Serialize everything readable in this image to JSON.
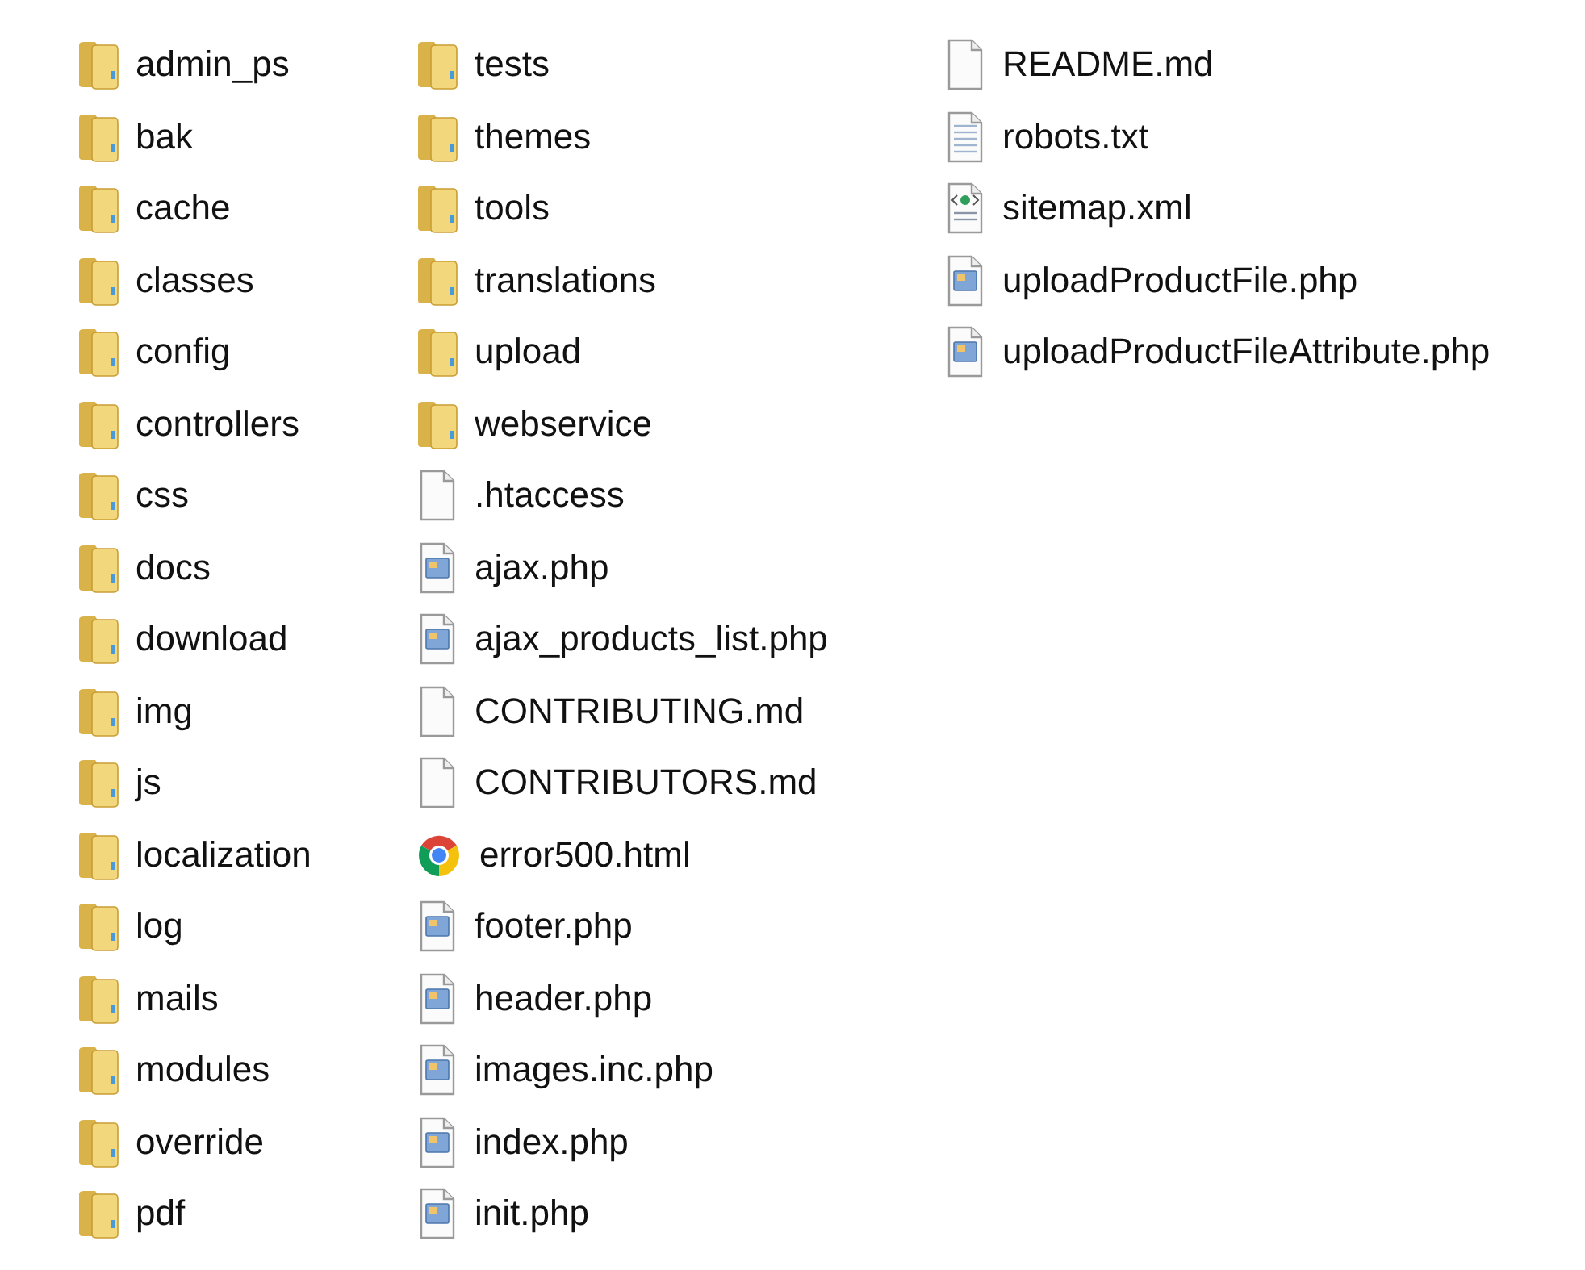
{
  "columns": [
    {
      "items": [
        {
          "kind": "folder",
          "name": "admin_ps"
        },
        {
          "kind": "folder",
          "name": "bak"
        },
        {
          "kind": "folder",
          "name": "cache"
        },
        {
          "kind": "folder",
          "name": "classes"
        },
        {
          "kind": "folder",
          "name": "config"
        },
        {
          "kind": "folder",
          "name": "controllers"
        },
        {
          "kind": "folder",
          "name": "css"
        },
        {
          "kind": "folder",
          "name": "docs"
        },
        {
          "kind": "folder",
          "name": "download"
        },
        {
          "kind": "folder",
          "name": "img"
        },
        {
          "kind": "folder",
          "name": "js"
        },
        {
          "kind": "folder",
          "name": "localization"
        },
        {
          "kind": "folder",
          "name": "log"
        },
        {
          "kind": "folder",
          "name": "mails"
        },
        {
          "kind": "folder",
          "name": "modules"
        },
        {
          "kind": "folder",
          "name": "override"
        },
        {
          "kind": "folder",
          "name": "pdf"
        }
      ]
    },
    {
      "items": [
        {
          "kind": "folder",
          "name": "tests"
        },
        {
          "kind": "folder",
          "name": "themes"
        },
        {
          "kind": "folder",
          "name": "tools"
        },
        {
          "kind": "folder",
          "name": "translations"
        },
        {
          "kind": "folder",
          "name": "upload"
        },
        {
          "kind": "folder",
          "name": "webservice"
        },
        {
          "kind": "blank",
          "name": ".htaccess"
        },
        {
          "kind": "php",
          "name": "ajax.php"
        },
        {
          "kind": "php",
          "name": "ajax_products_list.php"
        },
        {
          "kind": "blank",
          "name": "CONTRIBUTING.md"
        },
        {
          "kind": "blank",
          "name": "CONTRIBUTORS.md"
        },
        {
          "kind": "browser",
          "name": "error500.html"
        },
        {
          "kind": "php",
          "name": "footer.php"
        },
        {
          "kind": "php",
          "name": "header.php"
        },
        {
          "kind": "php",
          "name": "images.inc.php"
        },
        {
          "kind": "php",
          "name": "index.php"
        },
        {
          "kind": "php",
          "name": "init.php"
        }
      ]
    },
    {
      "items": [
        {
          "kind": "blank",
          "name": "README.md"
        },
        {
          "kind": "text",
          "name": "robots.txt"
        },
        {
          "kind": "xml",
          "name": "sitemap.xml"
        },
        {
          "kind": "php",
          "name": "uploadProductFile.php"
        },
        {
          "kind": "php",
          "name": "uploadProductFileAttribute.php"
        }
      ]
    }
  ]
}
